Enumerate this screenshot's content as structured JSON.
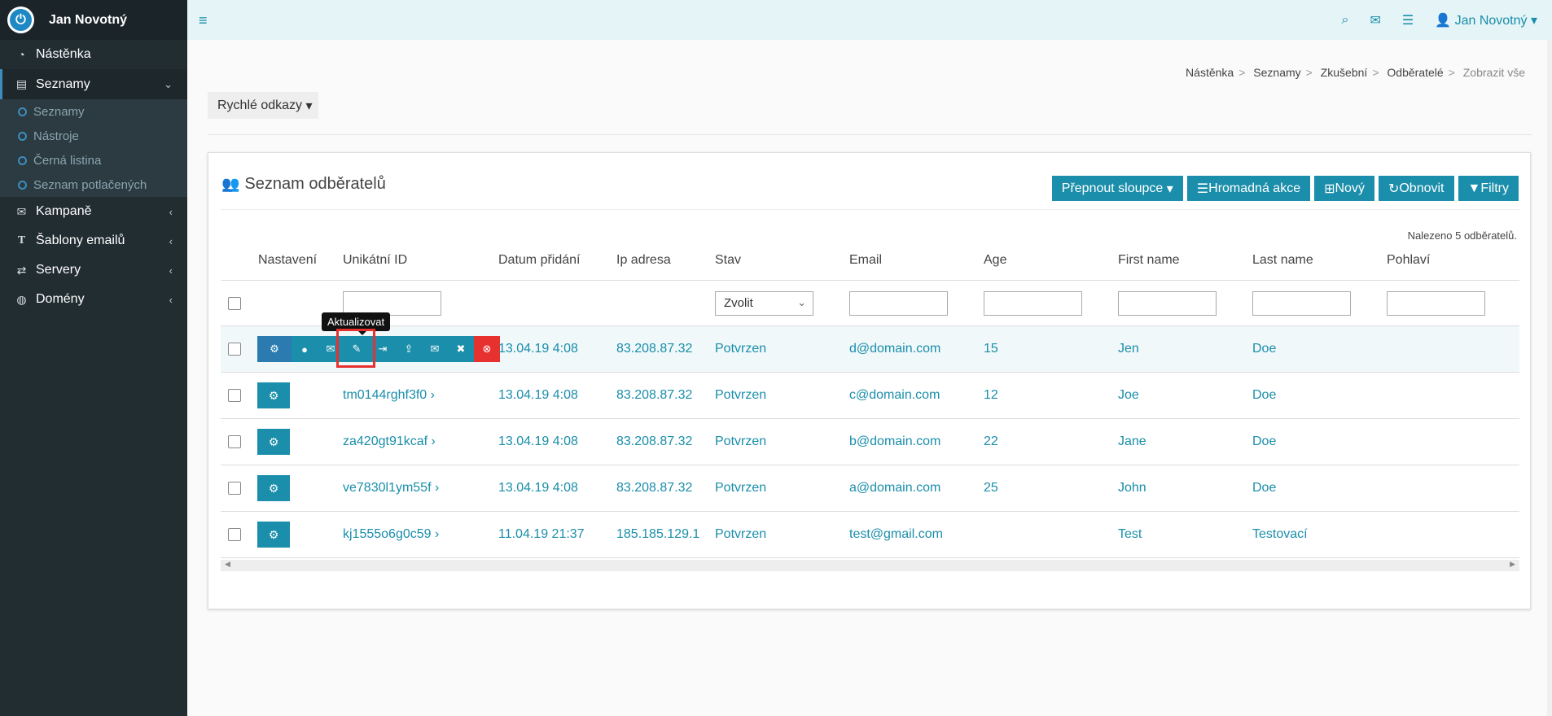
{
  "user": {
    "name": "Jan Novotný"
  },
  "sidebar": {
    "items": [
      {
        "label": "Nástěnka",
        "icon": "dashboard-icon"
      },
      {
        "label": "Seznamy",
        "icon": "list-icon",
        "active": true,
        "children": [
          "Seznamy",
          "Nástroje",
          "Černá listina",
          "Seznam potlačených"
        ]
      },
      {
        "label": "Kampaně",
        "icon": "envelope-icon"
      },
      {
        "label": "Šablony emailů",
        "icon": "text-icon"
      },
      {
        "label": "Servery",
        "icon": "exchange-icon"
      },
      {
        "label": "Domény",
        "icon": "globe-icon"
      }
    ]
  },
  "topbar": {
    "user_label": "Jan Novotný"
  },
  "breadcrumb": [
    "Nástěnka",
    "Seznamy",
    "Zkušební",
    "Odběratelé",
    "Zobrazit vše"
  ],
  "quick_links": "Rychlé odkazy",
  "panel": {
    "title": "Seznam odběratelů",
    "buttons": {
      "toggle_columns": "Přepnout sloupce",
      "bulk_action": "Hromadná akce",
      "new": "Nový",
      "refresh": "Obnovit",
      "filters": "Filtry"
    },
    "found": "Nalezeno 5 odběratelů."
  },
  "table": {
    "headers": [
      "Nastavení",
      "Unikátní ID",
      "Datum přidání",
      "Ip adresa",
      "Stav",
      "Email",
      "Age",
      "First name",
      "Last name",
      "Pohlaví"
    ],
    "filter_select": "Zvolit",
    "tooltip": "Aktualizovat",
    "rows": [
      {
        "uid": "",
        "date": "13.04.19 4:08",
        "ip": "83.208.87.32",
        "status": "Potvrzen",
        "email": "d@domain.com",
        "age": "15",
        "first": "Jen",
        "last": "Doe",
        "gender": ""
      },
      {
        "uid": "tm0144rghf3f0 ›",
        "date": "13.04.19 4:08",
        "ip": "83.208.87.32",
        "status": "Potvrzen",
        "email": "c@domain.com",
        "age": "12",
        "first": "Joe",
        "last": "Doe",
        "gender": ""
      },
      {
        "uid": "za420gt91kcaf ›",
        "date": "13.04.19 4:08",
        "ip": "83.208.87.32",
        "status": "Potvrzen",
        "email": "b@domain.com",
        "age": "22",
        "first": "Jane",
        "last": "Doe",
        "gender": ""
      },
      {
        "uid": "ve7830l1ym55f ›",
        "date": "13.04.19 4:08",
        "ip": "83.208.87.32",
        "status": "Potvrzen",
        "email": "a@domain.com",
        "age": "25",
        "first": "John",
        "last": "Doe",
        "gender": ""
      },
      {
        "uid": "kj1555o6g0c59 ›",
        "date": "11.04.19 21:37",
        "ip": "185.185.129.1",
        "status": "Potvrzen",
        "email": "test@gmail.com",
        "age": "",
        "first": "Test",
        "last": "Testovací",
        "gender": ""
      }
    ]
  }
}
